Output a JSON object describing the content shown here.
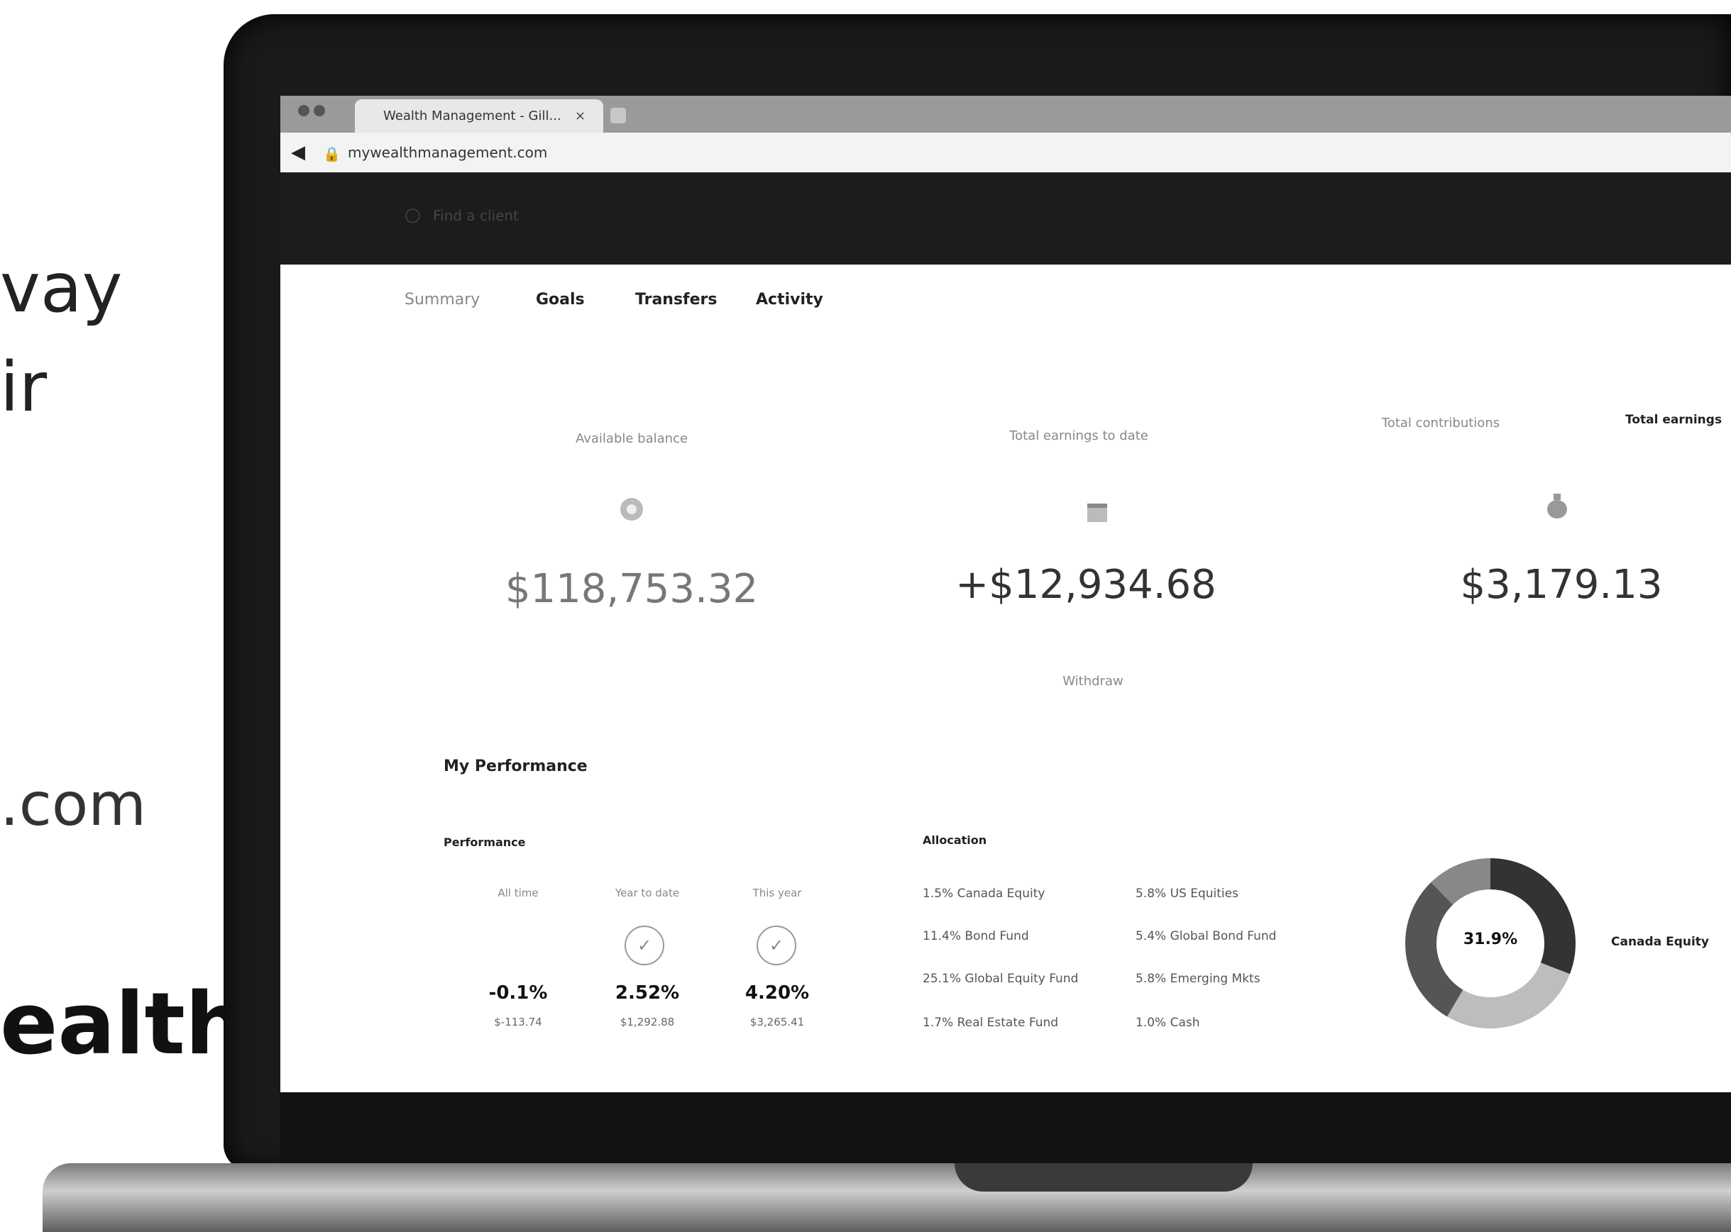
{
  "marketing": {
    "fragment_1": "vay",
    "fragment_2": "ir",
    "fragment_3": ".com",
    "fragment_4": "ealth"
  },
  "browser": {
    "tab_title": "Wealth Management - Gill...",
    "tab_close": "×",
    "url": "mywealthmanagement.com"
  },
  "header": {
    "search_placeholder": "Find a client"
  },
  "nav": {
    "tabs": [
      "Summary",
      "Goals",
      "Transfers",
      "Activity"
    ]
  },
  "stats": [
    {
      "label": "Available balance",
      "value": "$118,753.32"
    },
    {
      "label": "Total earnings to date",
      "value": "+$12,934.68"
    },
    {
      "label": "Total contributions",
      "value": "$3,179.13"
    }
  ],
  "stats_extra": {
    "top_right_label": "Total earnings",
    "link_below": "Withdraw"
  },
  "performance": {
    "section_title": "My Performance",
    "subsection_title": "Performance",
    "columns": [
      {
        "head": "All time",
        "pct": "-0.1%",
        "sub": "$-113.74",
        "has_check": false
      },
      {
        "head": "Year to date",
        "pct": "2.52%",
        "sub": "$1,292.88",
        "has_check": true
      },
      {
        "head": "This year",
        "pct": "4.20%",
        "sub": "$3,265.41",
        "has_check": true
      }
    ]
  },
  "allocation": {
    "title": "Allocation",
    "items": [
      "1.5%  Canada Equity",
      "11.4%  Bond Fund",
      "25.1%  Global Equity Fund",
      "1.7%  Real Estate Fund",
      "5.8%  US Equities",
      "5.4%  Global Bond Fund",
      "5.8%  Emerging Mkts",
      "1.0%  Cash"
    ],
    "donut_center": "31.9%",
    "legend_label": "Canada Equity",
    "donut_colors": [
      "#2b2b2b",
      "#555555",
      "#8a8a8a",
      "#b5b5b5",
      "#cfcfcf"
    ]
  }
}
